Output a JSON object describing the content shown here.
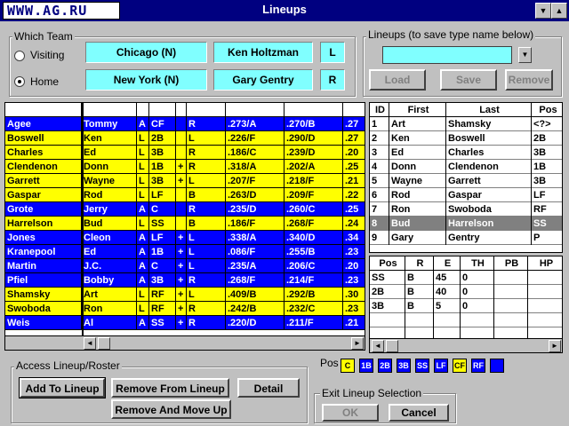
{
  "window": {
    "logo": "WWW.AG.RU",
    "title": "Lineups",
    "btn_down": "▼",
    "btn_up": "▲"
  },
  "team": {
    "label": "Which Team",
    "visiting_label": "Visiting",
    "home_label": "Home",
    "visiting_team": "Chicago (N)",
    "visiting_manager": "Ken Holtzman",
    "visiting_hand": "L",
    "home_team": "New York (N)",
    "home_manager": "Gary Gentry",
    "home_hand": "R"
  },
  "lineups": {
    "label": "Lineups (to save type name below)",
    "name_value": "",
    "load": "Load",
    "save": "Save",
    "remove": "Remove"
  },
  "roster": {
    "rows": [
      {
        "last": "Agee",
        "first": "Tommy",
        "b": "A",
        "pos": "CF",
        "x": "",
        "t": "R",
        "v1": ".273/A",
        "v2": ".270/B",
        "v3": ".27",
        "color": "blue"
      },
      {
        "last": "Boswell",
        "first": "Ken",
        "b": "L",
        "pos": "2B",
        "x": "",
        "t": "L",
        "v1": ".226/F",
        "v2": ".290/D",
        "v3": ".27",
        "color": "yellow"
      },
      {
        "last": "Charles",
        "first": "Ed",
        "b": "L",
        "pos": "3B",
        "x": "",
        "t": "R",
        "v1": ".186/C",
        "v2": ".239/D",
        "v3": ".20",
        "color": "yellow"
      },
      {
        "last": "Clendenon",
        "first": "Donn",
        "b": "L",
        "pos": "1B",
        "x": "+",
        "t": "R",
        "v1": ".318/A",
        "v2": ".202/A",
        "v3": ".25",
        "color": "yellow"
      },
      {
        "last": "Garrett",
        "first": "Wayne",
        "b": "L",
        "pos": "3B",
        "x": "+",
        "t": "L",
        "v1": ".207/F",
        "v2": ".218/F",
        "v3": ".21",
        "color": "yellow"
      },
      {
        "last": "Gaspar",
        "first": "Rod",
        "b": "L",
        "pos": "LF",
        "x": "",
        "t": "B",
        "v1": ".263/D",
        "v2": ".209/F",
        "v3": ".22",
        "color": "yellow"
      },
      {
        "last": "Grote",
        "first": "Jerry",
        "b": "A",
        "pos": "C",
        "x": "",
        "t": "R",
        "v1": ".235/D",
        "v2": ".260/C",
        "v3": ".25",
        "color": "blue"
      },
      {
        "last": "Harrelson",
        "first": "Bud",
        "b": "L",
        "pos": "SS",
        "x": "",
        "t": "B",
        "v1": ".186/F",
        "v2": ".268/F",
        "v3": ".24",
        "color": "yellow"
      },
      {
        "last": "Jones",
        "first": "Cleon",
        "b": "A",
        "pos": "LF",
        "x": "+",
        "t": "L",
        "v1": ".338/A",
        "v2": ".340/D",
        "v3": ".34",
        "color": "blue"
      },
      {
        "last": "Kranepool",
        "first": "Ed",
        "b": "A",
        "pos": "1B",
        "x": "+",
        "t": "L",
        "v1": ".086/F",
        "v2": ".255/B",
        "v3": ".23",
        "color": "blue"
      },
      {
        "last": "Martin",
        "first": "J.C.",
        "b": "A",
        "pos": "C",
        "x": "+",
        "t": "L",
        "v1": ".235/A",
        "v2": ".206/C",
        "v3": ".20",
        "color": "blue"
      },
      {
        "last": "Pfiel",
        "first": "Bobby",
        "b": "A",
        "pos": "3B",
        "x": "+",
        "t": "R",
        "v1": ".268/F",
        "v2": ".214/F",
        "v3": ".23",
        "color": "blue"
      },
      {
        "last": "Shamsky",
        "first": "Art",
        "b": "L",
        "pos": "RF",
        "x": "+",
        "t": "L",
        "v1": ".409/B",
        "v2": ".292/B",
        "v3": ".30",
        "color": "yellow"
      },
      {
        "last": "Swoboda",
        "first": "Ron",
        "b": "L",
        "pos": "RF",
        "x": "+",
        "t": "R",
        "v1": ".242/B",
        "v2": ".232/C",
        "v3": ".23",
        "color": "yellow"
      },
      {
        "last": "Weis",
        "first": "Al",
        "b": "A",
        "pos": "SS",
        "x": "+",
        "t": "R",
        "v1": ".220/D",
        "v2": ".211/F",
        "v3": ".21",
        "color": "blue"
      }
    ]
  },
  "lineup": {
    "headers": {
      "id": "ID",
      "first": "First",
      "last": "Last",
      "pos": "Pos"
    },
    "rows": [
      {
        "id": "1",
        "first": "Art",
        "last": "Shamsky",
        "pos": "<?>"
      },
      {
        "id": "2",
        "first": "Ken",
        "last": "Boswell",
        "pos": "2B"
      },
      {
        "id": "3",
        "first": "Ed",
        "last": "Charles",
        "pos": "3B"
      },
      {
        "id": "4",
        "first": "Donn",
        "last": "Clendenon",
        "pos": "1B"
      },
      {
        "id": "5",
        "first": "Wayne",
        "last": "Garrett",
        "pos": "3B"
      },
      {
        "id": "6",
        "first": "Rod",
        "last": "Gaspar",
        "pos": "LF"
      },
      {
        "id": "7",
        "first": "Ron",
        "last": "Swoboda",
        "pos": "RF"
      },
      {
        "id": "8",
        "first": "Bud",
        "last": "Harrelson",
        "pos": "SS"
      },
      {
        "id": "9",
        "first": "Gary",
        "last": "Gentry",
        "pos": "P"
      }
    ]
  },
  "fielding": {
    "headers": {
      "pos": "Pos",
      "r": "R",
      "e": "E",
      "th": "TH",
      "pb": "PB",
      "hp": "HP"
    },
    "rows": [
      {
        "pos": "SS",
        "r": "B",
        "e": "45",
        "th": "0"
      },
      {
        "pos": "2B",
        "r": "B",
        "e": "40",
        "th": "0"
      },
      {
        "pos": "3B",
        "r": "B",
        "e": "5",
        "th": "0"
      }
    ]
  },
  "access": {
    "label": "Access Lineup/Roster",
    "add": "Add To Lineup",
    "remove": "Remove From Lineup",
    "detail": "Detail",
    "remove_move": "Remove And Move Up"
  },
  "pos_legend": {
    "label": "Pos",
    "items": [
      {
        "label": "C",
        "color": "#ffff00",
        "text": "#000000"
      },
      {
        "label": "1B",
        "color": "#0000ff",
        "text": "#ffffff"
      },
      {
        "label": "2B",
        "color": "#0000ff",
        "text": "#ffffff"
      },
      {
        "label": "3B",
        "color": "#0000ff",
        "text": "#ffffff"
      },
      {
        "label": "SS",
        "color": "#0000ff",
        "text": "#ffffff"
      },
      {
        "label": "LF",
        "color": "#0000ff",
        "text": "#ffffff"
      },
      {
        "label": "CF",
        "color": "#ffff00",
        "text": "#000000"
      },
      {
        "label": "RF",
        "color": "#0000ff",
        "text": "#ffffff"
      },
      {
        "label": "",
        "color": "#0000ff",
        "text": "#ffffff"
      }
    ]
  },
  "exit": {
    "label": "Exit Lineup Selection",
    "ok": "OK",
    "cancel": "Cancel"
  },
  "scroll": {
    "left": "◄",
    "right": "►",
    "down": "▼"
  },
  "colors": {
    "yellow": "#ffff00",
    "blue": "#0000ff",
    "cyan": "#80ffff",
    "title": "#000080",
    "selected": "#808080"
  }
}
